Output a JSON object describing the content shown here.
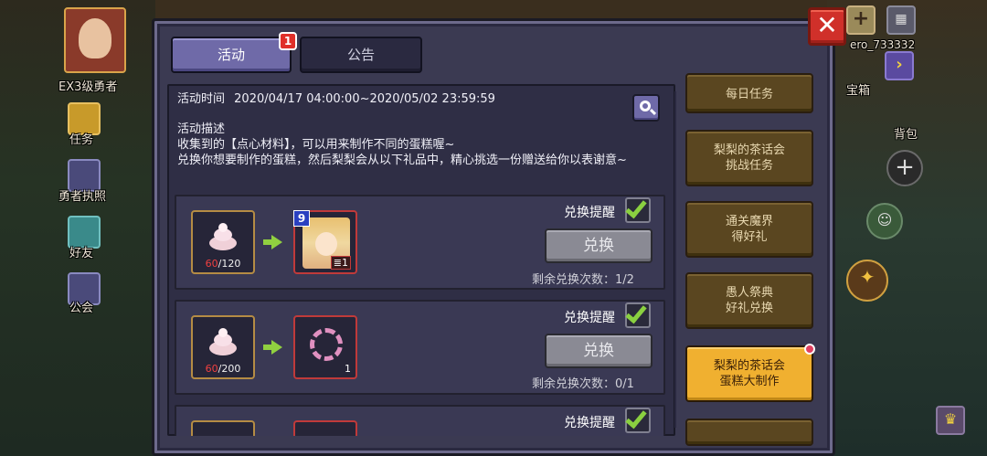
{
  "hud": {
    "hero_label": "EX3级勇者",
    "quest_label": "任务",
    "hero_badge_label": "勇者执照",
    "friends_label": "好友",
    "guild_label": "公会",
    "player_id": "ero_733332",
    "chest_label": "宝箱",
    "bag_label": "背包"
  },
  "modal": {
    "tabs": [
      {
        "label": "活动",
        "badge": "1",
        "active": true
      },
      {
        "label": "公告",
        "active": false
      }
    ],
    "close_glyph": "✕",
    "event_time_label": "活动时间",
    "event_time_value": "2020/04/17 04:00:00~2020/05/02 23:59:59",
    "desc_title": "活动描述",
    "desc_lines": [
      "收集到的【点心材料】，可以用来制作不同的蛋糕喔~",
      "兑换你想要制作的蛋糕，然后梨梨会从以下礼品中，精心挑选一份赠送给你以表谢意~"
    ],
    "rows": [
      {
        "material_have": "60",
        "material_need": "/120",
        "reward_level": "9",
        "reward_count": "1",
        "remind_label": "兑换提醒",
        "exchange_label": "兑换",
        "remain_label": "剩余兑换次数：1/2"
      },
      {
        "material_have": "60",
        "material_need": "/200",
        "reward_count": "1",
        "remind_label": "兑换提醒",
        "exchange_label": "兑换",
        "remain_label": "剩余兑换次数：0/1"
      },
      {
        "remind_label": "兑换提醒"
      }
    ],
    "side_menu": [
      {
        "label": "每日任务",
        "active": false
      },
      {
        "label": "梨梨的茶话会\n挑战任务",
        "active": false
      },
      {
        "label": "通关魔界\n得好礼",
        "active": false
      },
      {
        "label": "愚人祭典\n好礼兑换",
        "active": false
      },
      {
        "label": "梨梨的茶话会\n蛋糕大制作",
        "active": true
      }
    ]
  },
  "colors": {
    "panel": "#3b3a52",
    "tab_active": "#6f6aa8",
    "menu_gold": "#f0b030",
    "close_red": "#d0302a",
    "check_green": "#8ad040"
  }
}
